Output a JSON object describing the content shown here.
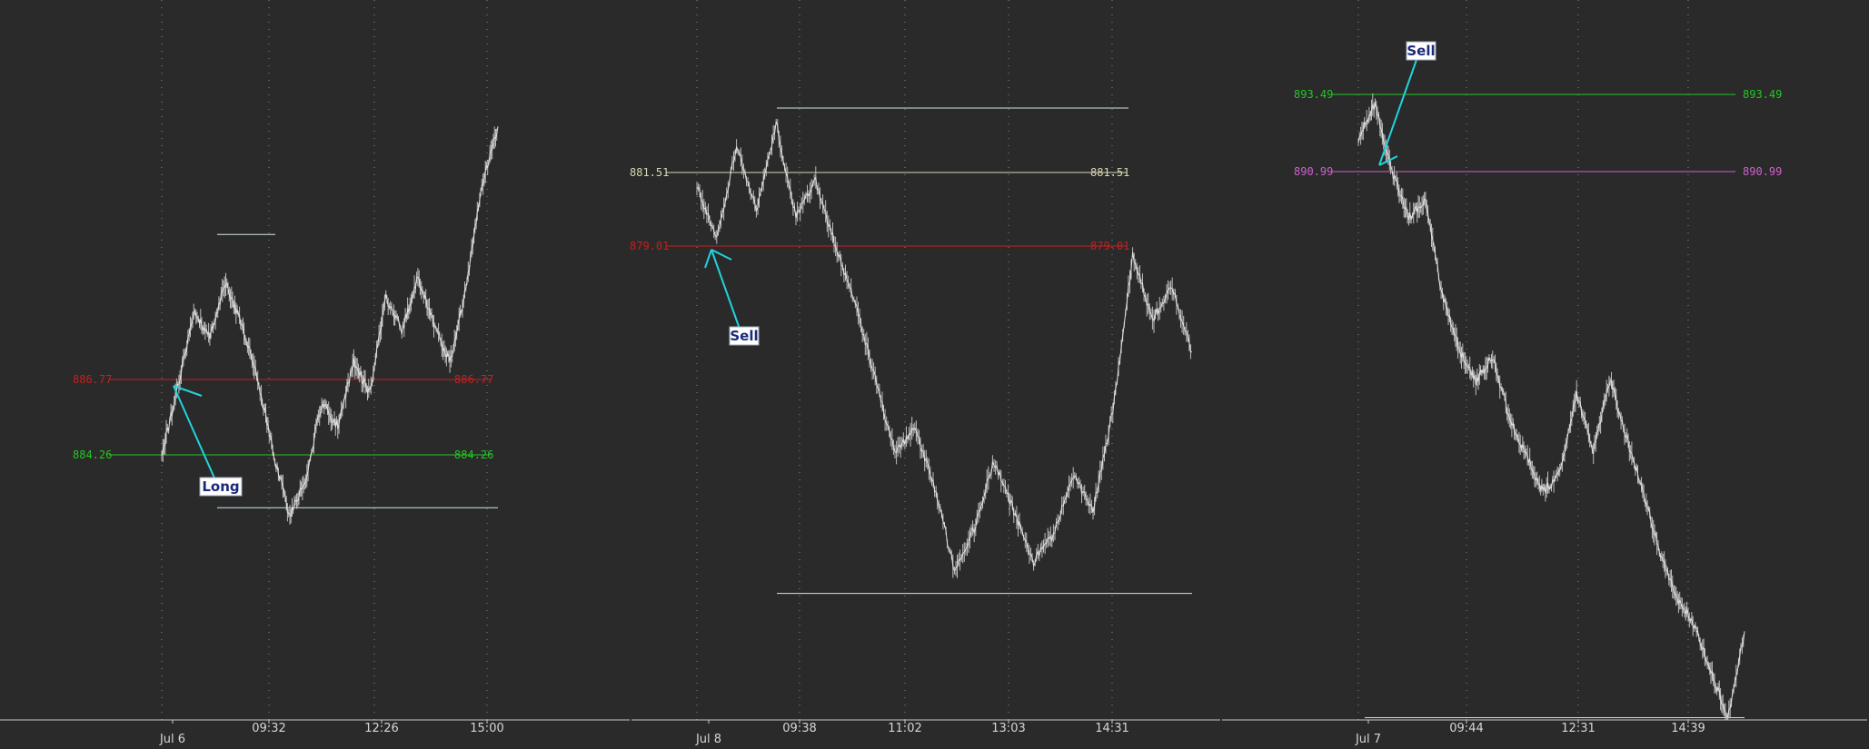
{
  "colors": {
    "background": "#2a2a2a",
    "grid": "#8a8a8a",
    "axis": "#c8c8c8",
    "price": "#bdbdbd",
    "range_box": "#cfe6ea",
    "annotation_arrow": "#22d3dc",
    "annotation_box": "#ffffff",
    "annotation_text": "#1b2a7a"
  },
  "chart_data": [
    {
      "type": "line",
      "session": "Jul 6",
      "x_tick_labels": [
        "Jul 6",
        "09:32",
        "12:26",
        "15:00"
      ],
      "levels": [
        {
          "value": 886.77,
          "label_left": "886.77",
          "label_right": "886.77",
          "color": "#c81e1e"
        },
        {
          "value": 884.26,
          "label_left": "884.26",
          "label_right": "884.26",
          "color": "#22c822"
        }
      ],
      "price_path": [
        884.26,
        886.5,
        889.0,
        888.2,
        890.0,
        888.6,
        886.77,
        884.26,
        882.2,
        883.5,
        886.0,
        885.2,
        887.4,
        886.3,
        889.5,
        888.4,
        890.2,
        888.6,
        887.3,
        889.8,
        893.2,
        895.2
      ],
      "range_box": {
        "high": 891.6,
        "low": 882.5
      },
      "annotation": {
        "text": "Long",
        "color": "#22d3dc"
      }
    },
    {
      "type": "line",
      "session": "Jul 8",
      "x_tick_labels": [
        "Jul 8",
        "09:38",
        "11:02",
        "13:03",
        "14:31"
      ],
      "levels": [
        {
          "value": 881.51,
          "label_left": "881.51",
          "label_right": "881.51",
          "color": "#d8d8b0"
        },
        {
          "value": 879.01,
          "label_left": "879.01",
          "label_right": "879.01",
          "color": "#c81e1e"
        }
      ],
      "price_path": [
        881.0,
        879.2,
        882.4,
        880.2,
        883.2,
        880.0,
        881.2,
        879.0,
        877.0,
        874.5,
        872.0,
        872.8,
        870.8,
        868.0,
        869.4,
        871.7,
        870.0,
        868.3,
        869.2,
        871.2,
        870.0,
        873.4,
        878.7,
        876.5,
        877.6,
        875.4
      ],
      "range_box": {
        "high": 883.7,
        "low": 867.2
      },
      "annotation": {
        "text": "Sell",
        "color": "#22d3dc"
      }
    },
    {
      "type": "line",
      "session": "Jul 7",
      "x_tick_labels": [
        "Jul 7",
        "09:44",
        "12:31",
        "14:39"
      ],
      "levels": [
        {
          "value": 893.49,
          "label_left": "893.49",
          "label_right": "893.49",
          "color": "#22c822"
        },
        {
          "value": 890.99,
          "label_left": "890.99",
          "label_right": "890.99",
          "color": "#d060d0"
        }
      ],
      "price_path": [
        892.0,
        893.2,
        891.0,
        889.5,
        890.0,
        887.0,
        885.2,
        884.2,
        885.0,
        883.0,
        881.8,
        880.6,
        881.2,
        883.8,
        882.0,
        884.3,
        882.3,
        880.5,
        878.6,
        877.2,
        876.3,
        874.8,
        873.3,
        876.1
      ],
      "range_box": {
        "high": 893.49,
        "low": 873.3
      },
      "annotation": {
        "text": "Sell",
        "color": "#22d3dc"
      }
    }
  ]
}
